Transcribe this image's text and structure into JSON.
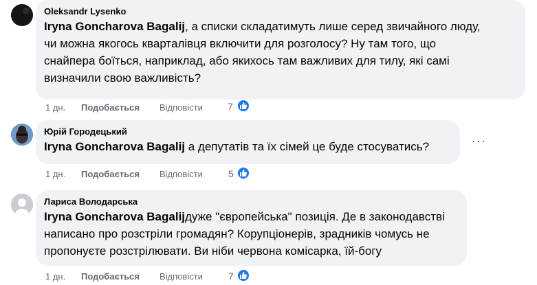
{
  "comments": [
    {
      "author": "Oleksandr Lysenko",
      "mention": "Iryna Goncharova Bagalij",
      "text_line1": ", а списки складатимуть лише серед звичайного люду,",
      "text_lines": [
        "чи можна якогось кварталівця включити для розголосу? Ну там того, що",
        "снайпера боїться, наприклад, або якихось там важливих для тилу, які самі",
        "визначили свою важливість?"
      ],
      "time": "1 дн.",
      "like_label": "Подобається",
      "reply_label": "Відповісти",
      "reactions": "7",
      "avatar": "dark-avatar"
    },
    {
      "author": "Юрій Городецький",
      "mention": "Iryna Goncharova Bagalij",
      "text_line1": " а депутатів та їх сімей це буде стосуватись?",
      "time": "1 дн.",
      "like_label": "Подобається",
      "reply_label": "Відповісти",
      "reactions": "5",
      "more": "···",
      "avatar": "photo-avatar"
    },
    {
      "author": "Лариса Володарська",
      "mention": "Iryna Goncharova Bagalij",
      "text_line1": "дуже \"європейська\" позиція. Де в законодавстві",
      "text_lines": [
        "написано про розстріли громадян? Корупціонерів, зрадників чомусь не",
        "пропонуєте розстрілювати. Ви ніби червона комісарка, їй-богу"
      ],
      "time": "1 дн.",
      "like_label": "Подобається",
      "reply_label": "Відповісти",
      "reactions": "7",
      "avatar": "default-avatar"
    }
  ],
  "colors": {
    "bubble": "#f0f2f5",
    "meta": "#65676b",
    "like_badge": "#1877f2"
  }
}
